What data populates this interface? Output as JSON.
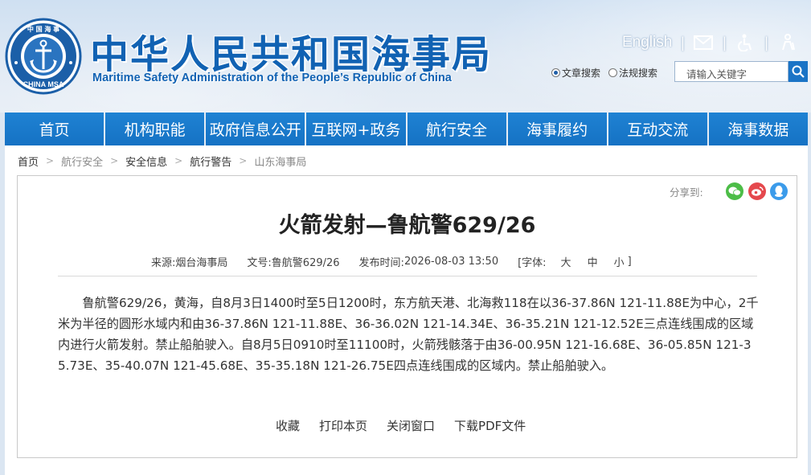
{
  "header": {
    "title_cn": "中华人民共和国海事局",
    "title_en": "Maritime Safety Administration of the People’s Republic of China",
    "logo_text_top": "中 国 海 事",
    "logo_text_bottom": "CHINA MSA",
    "english_link": "English",
    "icons": [
      "mail-icon",
      "accessibility-icon",
      "elder-care-icon"
    ],
    "search": {
      "radio_article": "文章搜索",
      "radio_law": "法规搜索",
      "placeholder": "请输入关键字"
    }
  },
  "nav": {
    "items": [
      "首页",
      "机构职能",
      "政府信息公开",
      "互联网+政务",
      "航行安全",
      "海事履约",
      "互动交流",
      "海事数据"
    ]
  },
  "breadcrumb": [
    "首页",
    "航行安全",
    "安全信息",
    "航行警告",
    "山东海事局"
  ],
  "article": {
    "share_label": "分享到:",
    "share_icons": [
      "wechat-icon",
      "weibo-icon",
      "qq-icon"
    ],
    "title": "火箭发射—鲁航警629/26",
    "source_label": "来源:",
    "source": "烟台海事局",
    "doc_label": "文号:",
    "doc_no": "鲁航警629/26",
    "time_label": "发布时间:",
    "time": "2026-08-03 13:50",
    "font_label": "[字体:",
    "font_large": "大",
    "font_medium": "中",
    "font_small": "小",
    "font_close": "]",
    "body": "鲁航警629/26，黄海，自8月3日1400时至5日1200时，东方航天港、北海救118在以36-37.86N 121-11.88E为中心，2千米为半径的圆形水域内和由36-37.86N 121-11.88E、36-36.02N 121-14.34E、36-35.21N 121-12.52E三点连线围成的区域内进行火箭发射。禁止船舶驶入。自8月5日0910时至11100时，火箭残骸落于由36-00.95N 121-16.68E、36-05.85N 121-35.73E、35-40.07N 121-45.68E、35-35.18N 121-26.75E四点连线围成的区域内。禁止船舶驶入。",
    "actions": {
      "favorite": "收藏",
      "print": "打印本页",
      "close": "关闭窗口",
      "download": "下载PDF文件"
    }
  },
  "colors": {
    "brand_blue": "#1162b3",
    "nav_blue": "#1877c9"
  }
}
